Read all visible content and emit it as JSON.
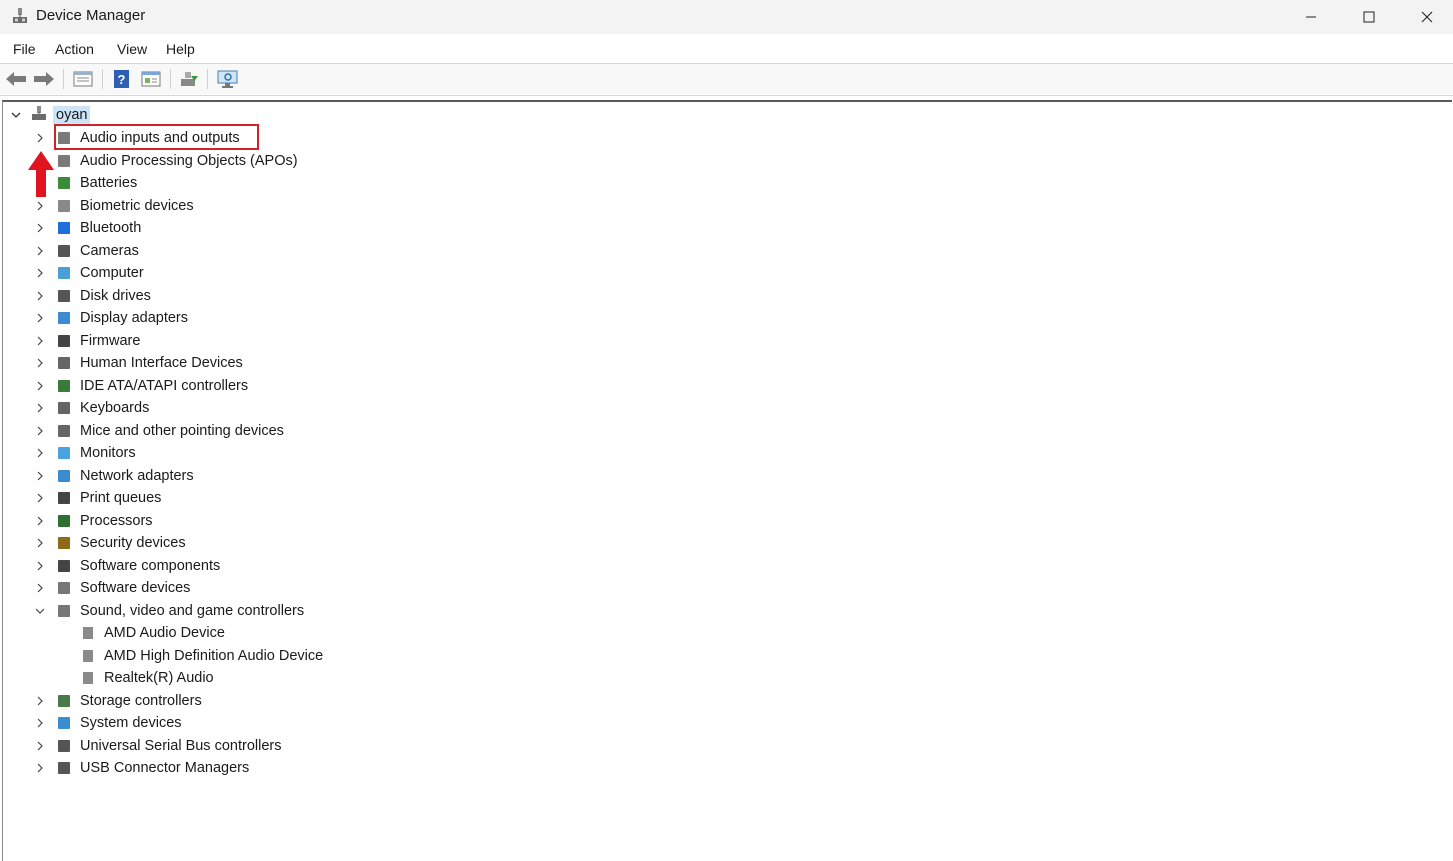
{
  "window": {
    "title": "Device Manager"
  },
  "menu": [
    "File",
    "Action",
    "View",
    "Help"
  ],
  "toolbar": {
    "buttons": [
      "back-arrow-icon",
      "forward-arrow-icon",
      "properties-icon",
      "help-icon",
      "run-icon",
      "update-driver-icon",
      "scan-hardware-icon"
    ]
  },
  "tree": {
    "root": "oyan",
    "categories": [
      "Audio inputs and outputs",
      "Audio Processing Objects (APOs)",
      "Batteries",
      "Biometric devices",
      "Bluetooth",
      "Cameras",
      "Computer",
      "Disk drives",
      "Display adapters",
      "Firmware",
      "Human Interface Devices",
      "IDE ATA/ATAPI controllers",
      "Keyboards",
      "Mice and other pointing devices",
      "Monitors",
      "Network adapters",
      "Print queues",
      "Processors",
      "Security devices",
      "Software components",
      "Software devices",
      "Sound, video and game controllers",
      "Storage controllers",
      "System devices",
      "Universal Serial Bus controllers",
      "USB Connector Managers"
    ],
    "sound_children": [
      "AMD Audio Device",
      "AMD High Definition Audio Device",
      "Realtek(R) Audio"
    ]
  },
  "annotation": {
    "highlight_color": "#d0232a"
  }
}
